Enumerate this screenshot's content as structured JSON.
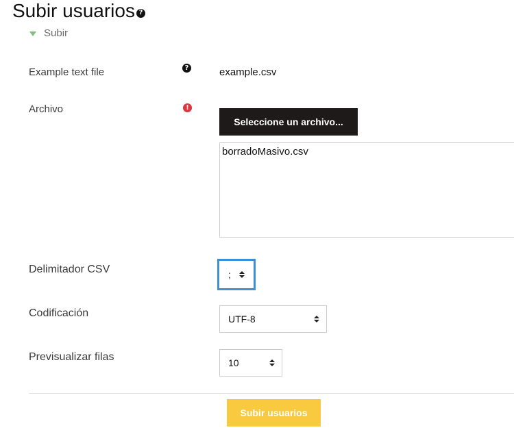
{
  "page": {
    "title": "Subir usuarios",
    "title_help_icon": "question-circle-icon"
  },
  "section": {
    "label": "Subir",
    "expanded": true
  },
  "fields": {
    "example": {
      "label": "Example text file",
      "icon": "question-circle-icon",
      "value": "example.csv"
    },
    "archivo": {
      "label": "Archivo",
      "icon": "required-exclamation-icon",
      "button_label": "Seleccione un archivo...",
      "selected_file": "borradoMasivo.csv"
    },
    "delimitador": {
      "label": "Delimitador CSV",
      "value": ";"
    },
    "codificacion": {
      "label": "Codificación",
      "value": "UTF-8"
    },
    "previsualizar": {
      "label": "Previsualizar filas",
      "value": "10"
    }
  },
  "actions": {
    "submit_label": "Subir usuarios"
  },
  "colors": {
    "submit_button": "#f9c940",
    "file_button": "#1f1a1a",
    "focus_ring": "#3d8fd6",
    "required_icon": "#d9363e",
    "section_triangle": "#7fbf7f"
  }
}
